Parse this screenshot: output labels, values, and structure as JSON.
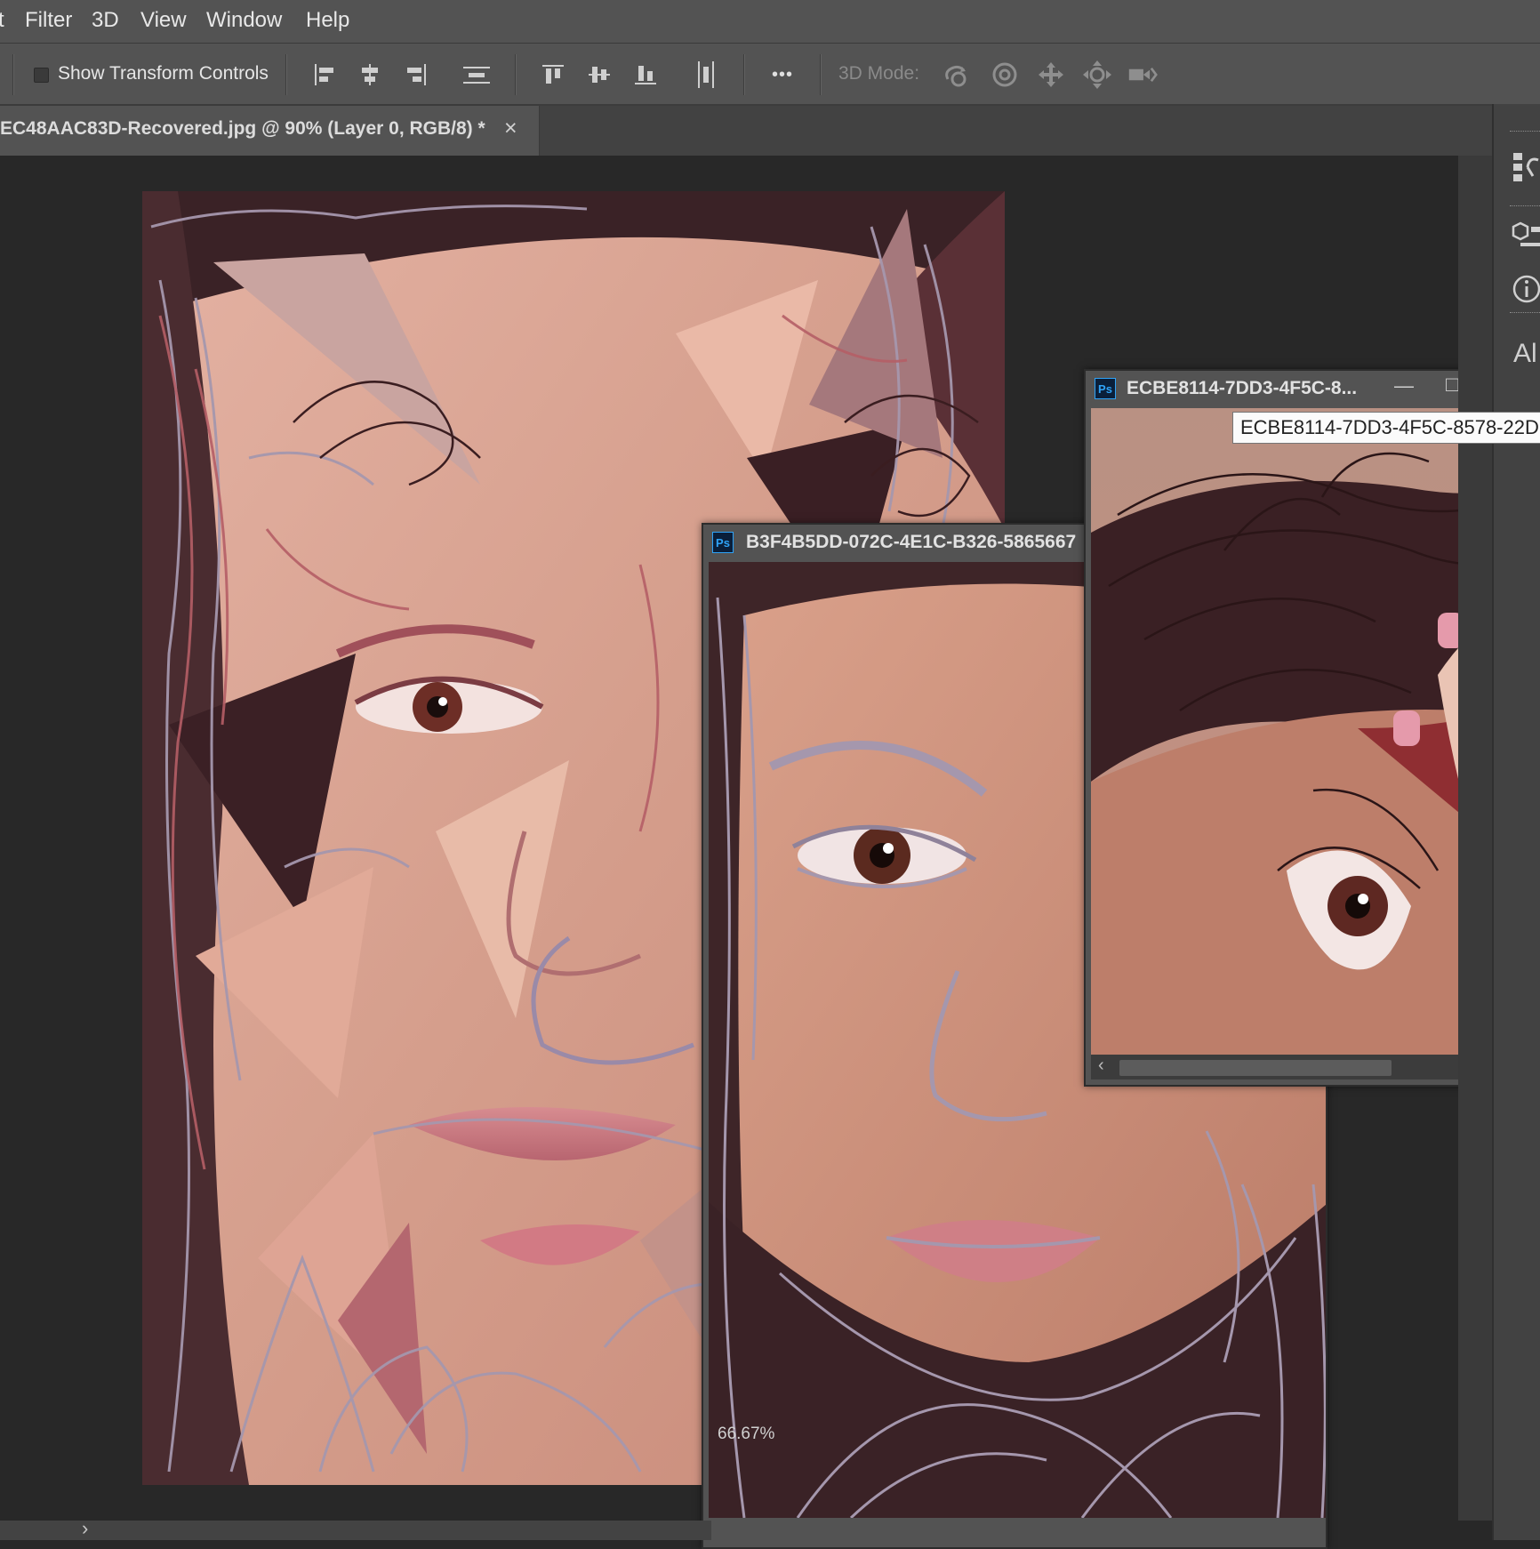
{
  "menu": {
    "items": [
      "t",
      "Filter",
      "3D",
      "View",
      "Window",
      "Help"
    ]
  },
  "options_bar": {
    "show_transform_controls_label": "Show Transform Controls",
    "show_transform_controls_checked": false,
    "more_label": "•••",
    "mode_3d_label": "3D Mode:",
    "icons": [
      "align-left-icon",
      "align-hcenter-icon",
      "align-right-icon",
      "distribute-horizontal-icon",
      "align-top-icon",
      "align-vcenter-icon",
      "align-bottom-icon",
      "distribute-vertical-icon",
      "orbit-3d-icon",
      "roll-3d-icon",
      "pan-3d-icon",
      "slide-3d-icon",
      "scale-3d-icon"
    ]
  },
  "document_tab": {
    "title": "EC48AAC83D-Recovered.jpg @ 90% (Layer 0, RGB/8) *",
    "close_label": "×"
  },
  "windows": [
    {
      "ps_label": "Ps",
      "title": "B3F4B5DD-072C-4E1C-B326-5865667",
      "zoom": "66.67%"
    },
    {
      "ps_label": "Ps",
      "title": "ECBE8114-7DD3-4F5C-8...",
      "tooltip": "ECBE8114-7DD3-4F5C-8578-22D",
      "minimize_label": "—",
      "maximize_label": "□",
      "close_label": "✕"
    }
  ],
  "right_panel": {
    "partial_text": "Al",
    "icons": [
      "history-icon",
      "3d-layers-icon",
      "info-icon"
    ]
  },
  "status_bar": {
    "arrow": "›"
  },
  "colors": {
    "ui_dark": "#282828",
    "ui_panel": "#535353",
    "skin": "#d69f8b",
    "hair_line": "#a597ad",
    "ps_blue": "#2fa3f7"
  }
}
